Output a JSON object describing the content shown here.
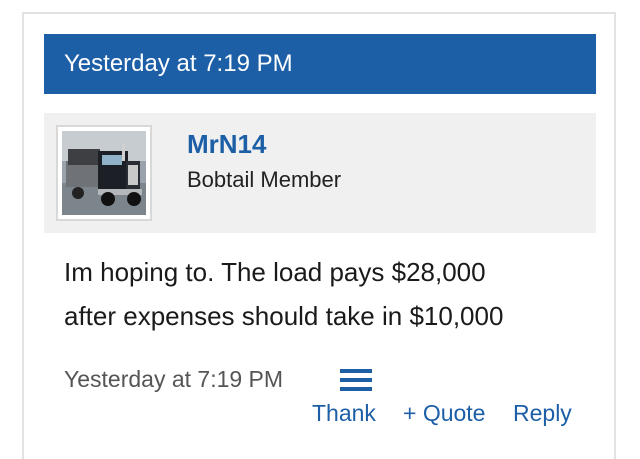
{
  "header": {
    "timestamp": "Yesterday at 7:19 PM"
  },
  "user": {
    "name": "MrN14",
    "title": "Bobtail Member",
    "avatar_icon": "truck-avatar-icon"
  },
  "message": {
    "lines": [
      "Im hoping to. The load pays $28,000",
      "after expenses should take in $10,000"
    ]
  },
  "footer": {
    "timestamp": "Yesterday at 7:19 PM",
    "menu_icon": "hamburger-menu-icon",
    "actions": {
      "thank": "Thank",
      "quote": "+ Quote",
      "reply": "Reply"
    }
  },
  "colors": {
    "accent": "#1c5fa7",
    "userbox_bg": "#f0f0f0",
    "border": "#e2e2e2"
  }
}
